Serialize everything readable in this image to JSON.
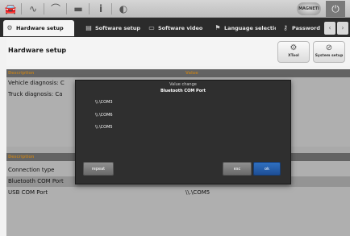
{
  "topbar": {
    "icons": [
      "car-icon",
      "waveform-icon",
      "connector-icon",
      "folder-icon",
      "info-icon",
      "bulb-icon"
    ],
    "brand": "MAGNETI",
    "power_icon": "power-icon"
  },
  "tabs": [
    {
      "label": "Hardware setup",
      "icon": "gear-icon"
    },
    {
      "label": "Software setup",
      "icon": "document-icon"
    },
    {
      "label": "Software video",
      "icon": "monitor-icon"
    },
    {
      "label": "Language selection",
      "icon": "flag-icon"
    },
    {
      "label": "Password",
      "icon": "key-icon"
    }
  ],
  "header": {
    "title": "Hardware setup",
    "buttons": [
      {
        "label": "XTool",
        "icon": "gear-icon"
      },
      {
        "label": "System setup",
        "icon": "compass-icon"
      }
    ]
  },
  "table_top": {
    "columns": [
      "Description",
      "Value"
    ],
    "rows": [
      {
        "description": "Vehicle diagnosis: C",
        "value": ""
      },
      {
        "description": "Truck diagnosis: Ca",
        "value": ""
      }
    ]
  },
  "table_bottom": {
    "columns": [
      "Description",
      ""
    ],
    "rows": [
      {
        "description": "Connection type",
        "value": ""
      },
      {
        "description": "Bluetooth COM Port",
        "value": ""
      },
      {
        "description": "USB COM Port",
        "value": "\\\\.\\COM5"
      }
    ]
  },
  "dialog": {
    "title": "Value change",
    "subtitle": "Bluetooth COM Port",
    "options": [
      "\\\\.\\COM3",
      "\\\\.\\COM6",
      "\\\\.\\COM5"
    ],
    "repeat_label": "repeat",
    "esc_label": "esc",
    "ok_label": "ok"
  },
  "colors": {
    "header_accent": "#ffb23a",
    "ok_button": "#2f6fc0"
  }
}
